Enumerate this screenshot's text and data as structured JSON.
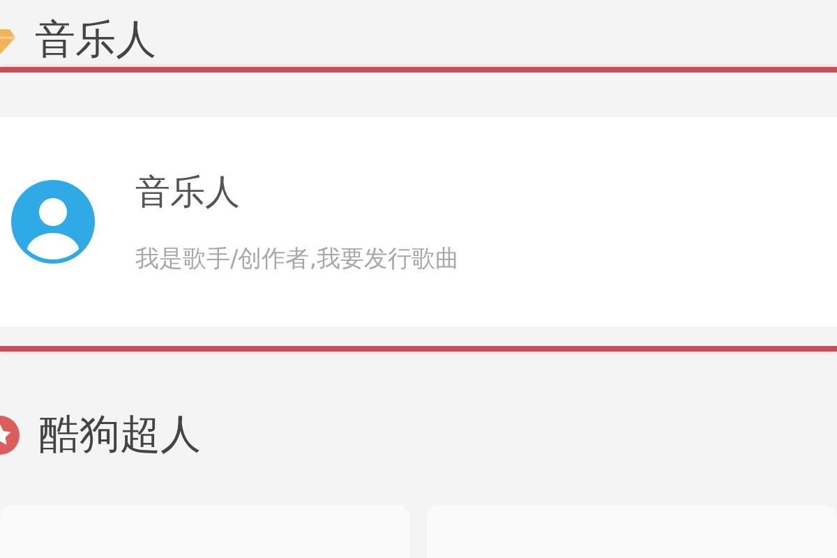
{
  "sections": [
    {
      "title": "音乐人",
      "highlighted": true,
      "cards": [
        {
          "kind": "profile",
          "title": "音乐人",
          "subtitle": "我是歌手/创作者,我要发行歌曲"
        }
      ]
    },
    {
      "title": "酷狗超人",
      "highlighted": false,
      "cards": [
        {
          "kind": "blank"
        },
        {
          "kind": "blank"
        }
      ]
    }
  ]
}
